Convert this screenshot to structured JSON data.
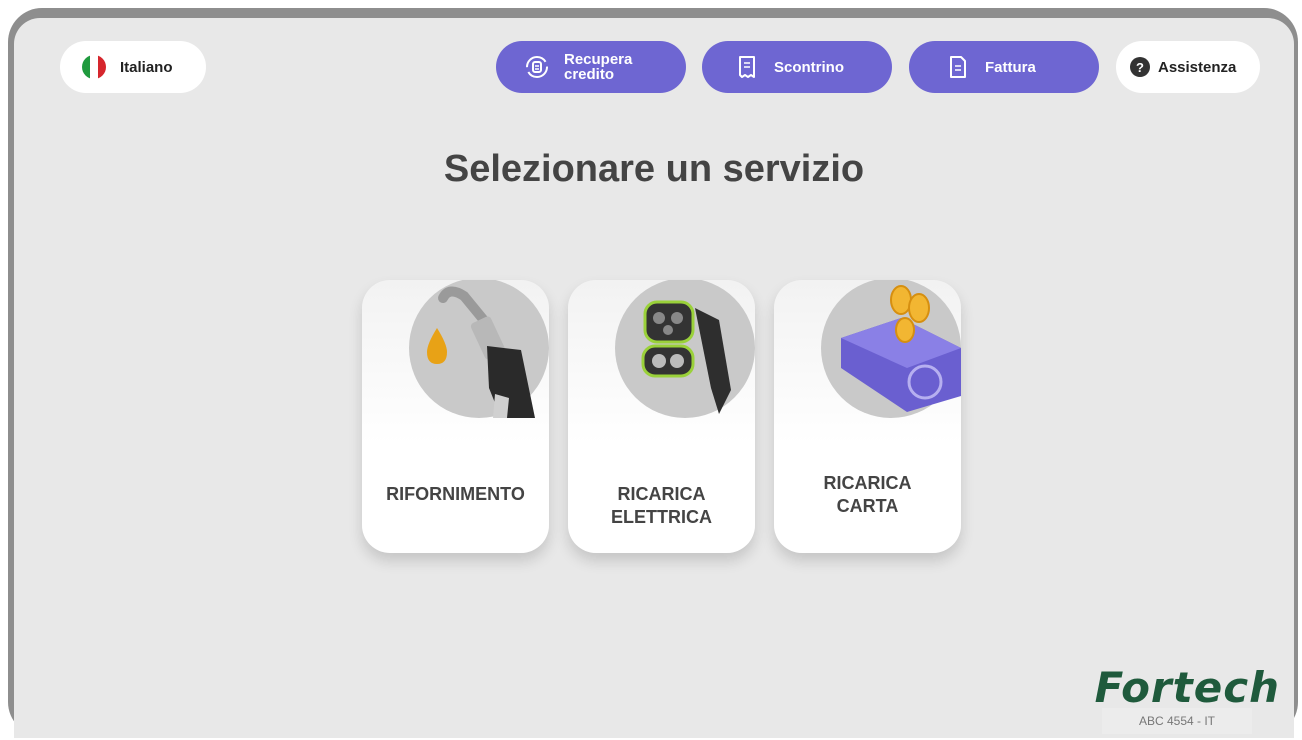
{
  "header": {
    "language_label": "Italiano",
    "recupera_label": "Recupera credito",
    "scontrino_label": "Scontrino",
    "fattura_label": "Fattura",
    "assistenza_label": "Assistenza"
  },
  "main": {
    "title": "Selezionare un servizio",
    "services": [
      {
        "label": "RIFORNIMENTO",
        "icon": "fuel-nozzle-icon"
      },
      {
        "label": "RICARICA ELETTRICA",
        "icon": "ev-charger-icon"
      },
      {
        "label": "RICARICA CARTA",
        "icon": "card-coins-icon"
      }
    ]
  },
  "footer": {
    "brand": "Fortech",
    "device_id": "ABC 4554 - IT"
  },
  "colors": {
    "accent": "#6e66d2",
    "background": "#e8e8e8",
    "brand_green": "#1f5a3c"
  }
}
